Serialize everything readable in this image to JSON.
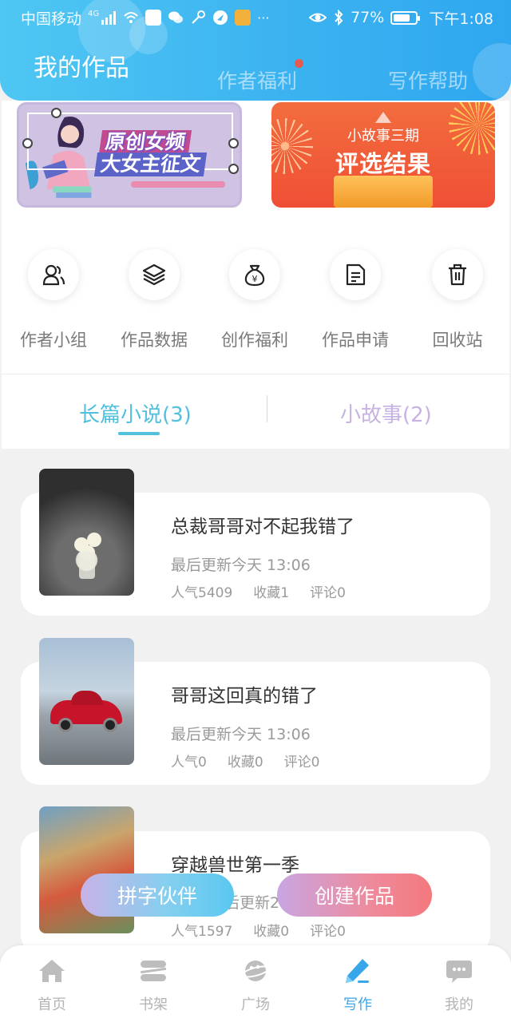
{
  "status_bar": {
    "carrier": "中国移动",
    "network": "4G",
    "battery": "77%",
    "time": "下午1:08",
    "ellipsis": "···"
  },
  "header": {
    "tabs": [
      {
        "label": "我的作品",
        "active": true
      },
      {
        "label": "作者福利",
        "active": false,
        "has_dot": true
      },
      {
        "label": "写作帮助",
        "active": false
      }
    ]
  },
  "banners": {
    "left": {
      "line1": "原创女频",
      "line2": "大女主征文"
    },
    "right": {
      "small": "小故事三期",
      "big": "评选结果"
    }
  },
  "quick_actions": [
    {
      "label": "作者小组",
      "icon": "users-icon"
    },
    {
      "label": "作品数据",
      "icon": "layers-icon"
    },
    {
      "label": "创作福利",
      "icon": "money-bag-icon"
    },
    {
      "label": "作品申请",
      "icon": "document-icon"
    },
    {
      "label": "回收站",
      "icon": "trash-icon"
    }
  ],
  "sub_tabs": [
    {
      "label": "长篇小说(3)",
      "active": true
    },
    {
      "label": "小故事(2)",
      "active": false
    }
  ],
  "works": [
    {
      "title": "总裁哥哥对不起我错了",
      "updated": "最后更新今天 13:06",
      "popularity": "人气5409",
      "favorites": "收藏1",
      "comments": "评论0"
    },
    {
      "title": "哥哥这回真的错了",
      "updated": "最后更新今天 13:06",
      "popularity": "人气0",
      "favorites": "收藏0",
      "comments": "评论0"
    },
    {
      "title": "穿越兽世第一季",
      "updated": "最后更新2021-",
      "popularity": "人气1597",
      "favorites": "收藏0",
      "comments": "评论0"
    }
  ],
  "floating_buttons": {
    "partner": "拼字伙伴",
    "create": "创建作品"
  },
  "bottom_nav": [
    {
      "label": "首页",
      "icon": "home-icon",
      "active": false
    },
    {
      "label": "书架",
      "icon": "bookshelf-icon",
      "active": false
    },
    {
      "label": "广场",
      "icon": "planet-icon",
      "active": false
    },
    {
      "label": "写作",
      "icon": "pen-icon",
      "active": true
    },
    {
      "label": "我的",
      "icon": "chat-bubble-icon",
      "active": false
    }
  ],
  "colors": {
    "header_gradient_start": "#4fc7f3",
    "header_gradient_end": "#2fa7f0",
    "accent_cyan": "#51c0de",
    "accent_purple": "#c7b3e2",
    "nav_active": "#37a6ea",
    "notification_dot": "#e85a4f"
  }
}
